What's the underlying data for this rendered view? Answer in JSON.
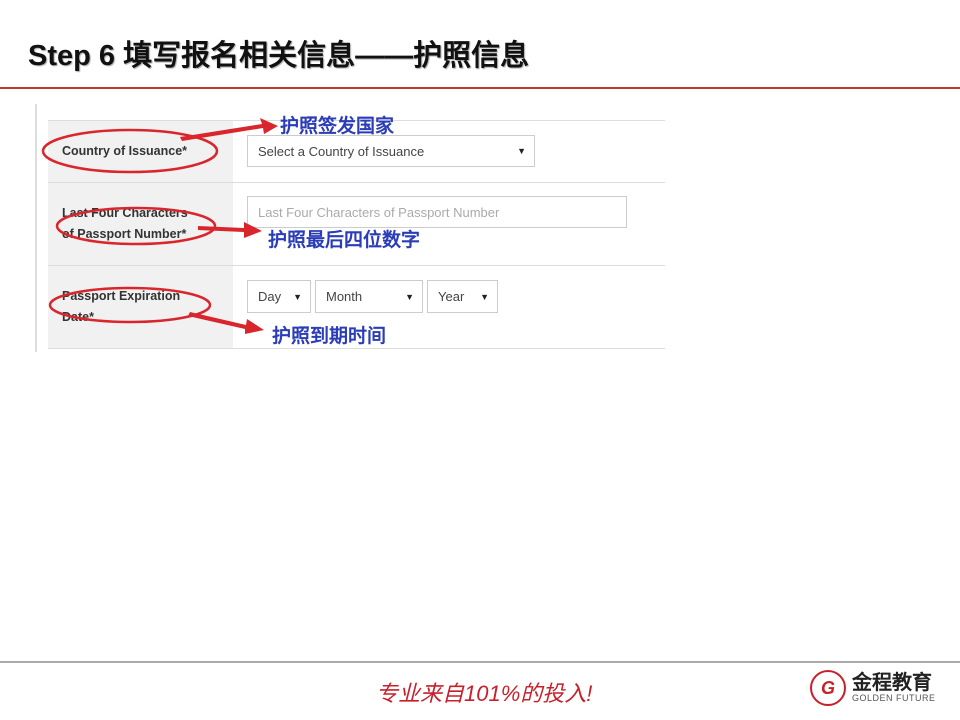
{
  "title": "Step 6 填写报名相关信息——护照信息",
  "form": {
    "country": {
      "label": "Country of Issuance*",
      "value": "Select a Country of Issuance",
      "note": "护照签发国家"
    },
    "passport_last4": {
      "label_line1": "Last Four Characters",
      "label_line2": "of Passport Number*",
      "placeholder": "Last Four Characters of Passport Number",
      "note": "护照最后四位数字"
    },
    "expiration": {
      "label_line1": "Passport Expiration",
      "label_line2": "Date*",
      "day": "Day",
      "month": "Month",
      "year": "Year",
      "note": "护照到期时间"
    }
  },
  "icons": {
    "dropdown": "▼"
  },
  "colors": {
    "accent": "#c0392b",
    "note": "#2a3cb8"
  },
  "footer": {
    "slogan": "专业来自101%的投入!",
    "brand_cn": "金程教育",
    "brand_en": "GOLDEN FUTURE"
  }
}
